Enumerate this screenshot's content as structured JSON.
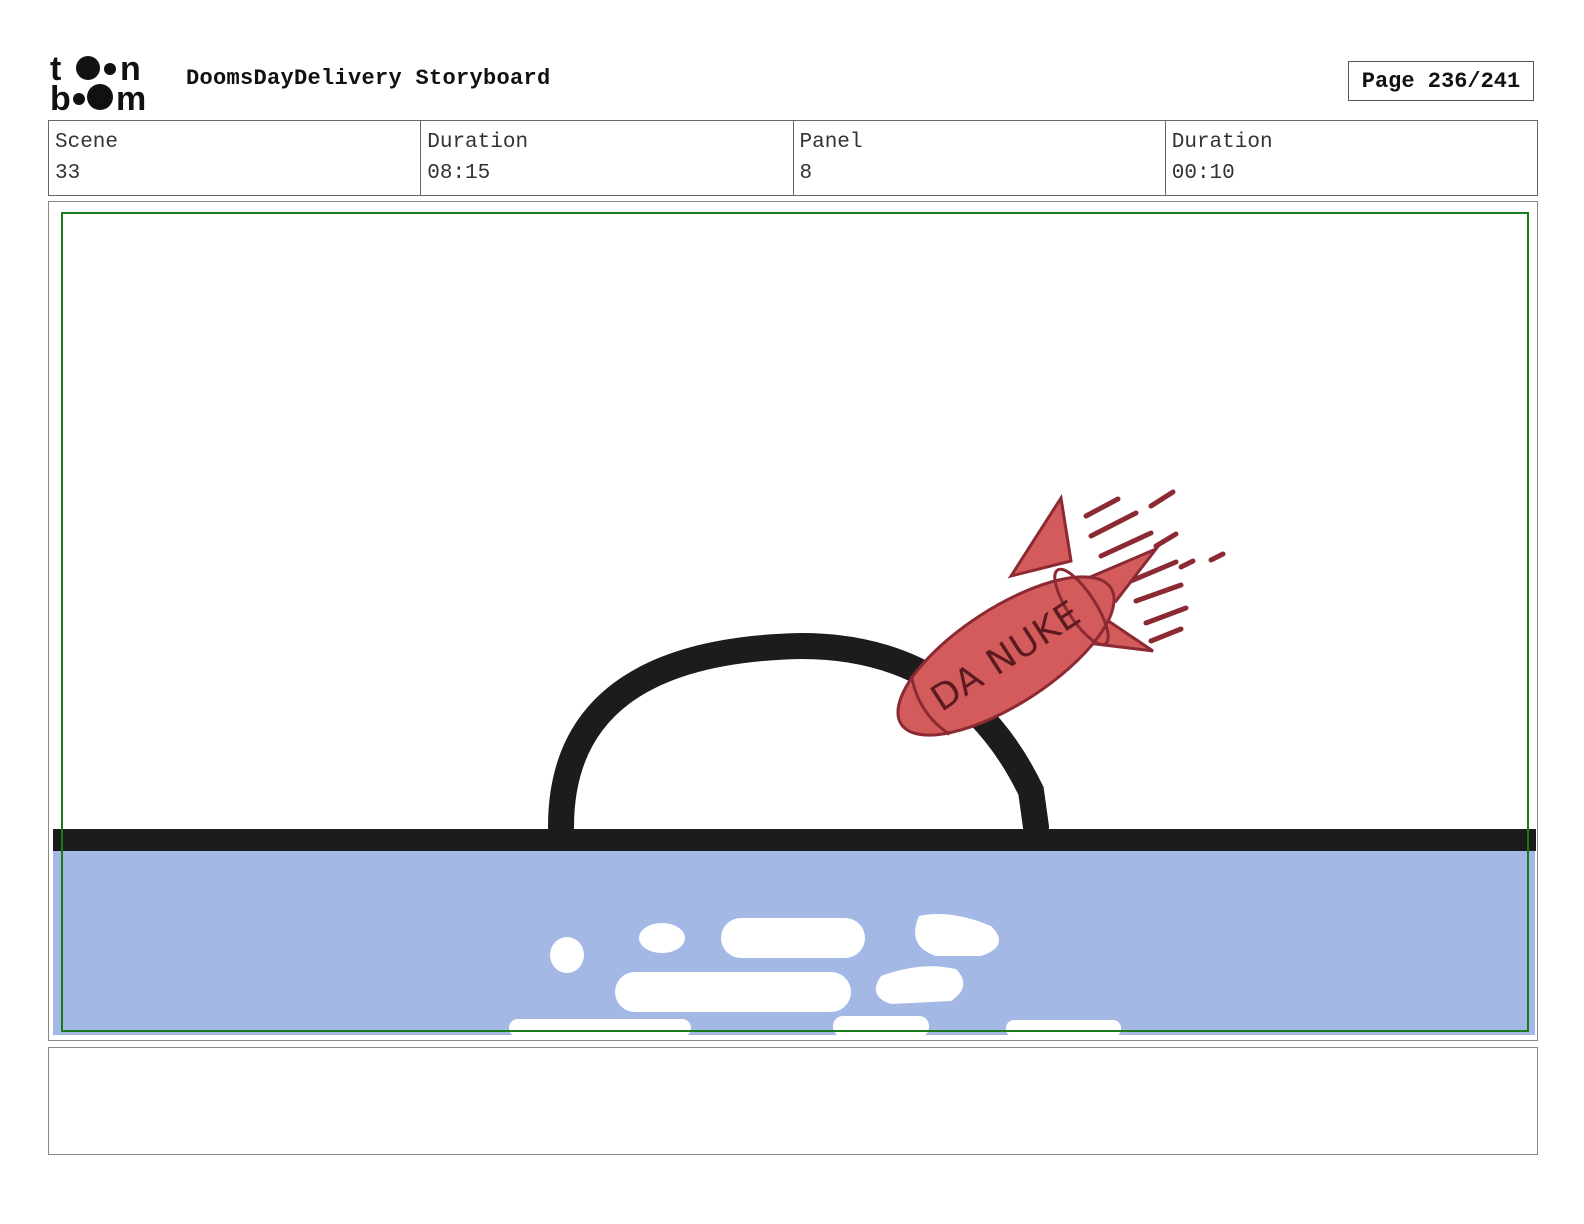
{
  "header": {
    "logo_name": "toon boom",
    "title": "DoomsDayDelivery Storyboard",
    "page_label": "Page 236/241"
  },
  "info": {
    "scene_label": "Scene",
    "scene_value": "33",
    "scene_duration_label": "Duration",
    "scene_duration_value": "08:15",
    "panel_label": "Panel",
    "panel_value": "8",
    "panel_duration_label": "Duration",
    "panel_duration_value": "00:10"
  },
  "panel": {
    "missile_text": "DA NUKE",
    "safe_area_color": "#1a7a1a",
    "water_color": "#a4b8e6",
    "missile_color": "#d35b5b",
    "outline_color": "#1c1c1c"
  },
  "notes": {
    "text": ""
  }
}
